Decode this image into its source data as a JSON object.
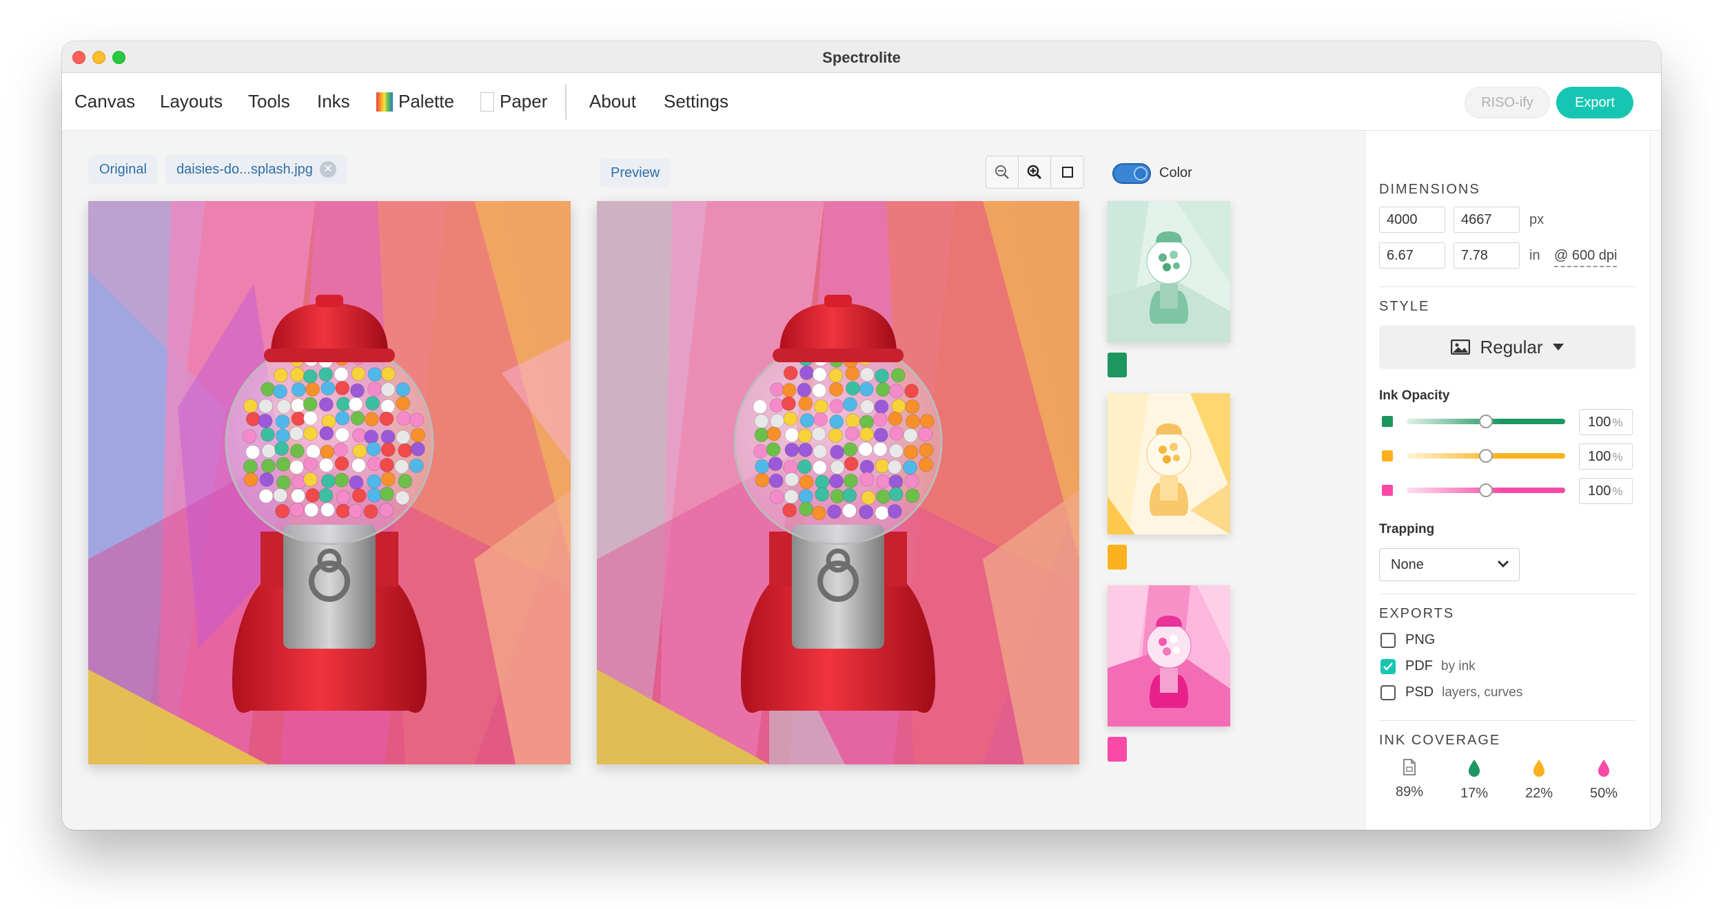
{
  "window": {
    "title": "Spectrolite"
  },
  "menu": {
    "items": [
      "Canvas",
      "Layouts",
      "Tools",
      "Inks"
    ],
    "palette_label": "Palette",
    "paper_label": "Paper",
    "about_label": "About",
    "settings_label": "Settings"
  },
  "actions": {
    "riso_label": "RISO-ify",
    "export_label": "Export"
  },
  "workspace": {
    "original_tab": "Original",
    "file_name": "daisies-do...splash.jpg",
    "preview_tab": "Preview",
    "color_toggle_label": "Color",
    "color_toggle_on": true
  },
  "inks": [
    {
      "name": "green",
      "color": "#1e9660"
    },
    {
      "name": "yellow",
      "color": "#fbb11d"
    },
    {
      "name": "pink",
      "color": "#f94aa8"
    }
  ],
  "sidebar": {
    "dimensions": {
      "title": "DIMENSIONS",
      "width_px": "4000",
      "height_px": "4667",
      "px_unit": "px",
      "width_in": "6.67",
      "height_in": "7.78",
      "in_unit": "in",
      "dpi": "@ 600 dpi"
    },
    "style": {
      "title": "STYLE",
      "value": "Regular"
    },
    "ink_opacity": {
      "label": "Ink Opacity",
      "rows": [
        {
          "value": "100",
          "unit": "%",
          "color": "#1e9660",
          "level": 0.5
        },
        {
          "value": "100",
          "unit": "%",
          "color": "#fbb11d",
          "level": 0.5
        },
        {
          "value": "100",
          "unit": "%",
          "color": "#f94aa8",
          "level": 0.5
        }
      ]
    },
    "trapping": {
      "label": "Trapping",
      "value": "None"
    },
    "exports": {
      "title": "EXPORTS",
      "items": [
        {
          "label": "PNG",
          "sub": "",
          "checked": false
        },
        {
          "label": "PDF",
          "sub": "by ink",
          "checked": true
        },
        {
          "label": "PSD",
          "sub": "layers, curves",
          "checked": false
        }
      ]
    },
    "coverage": {
      "title": "INK COVERAGE",
      "items": [
        {
          "icon": "paper-icon",
          "value": "89%"
        },
        {
          "icon": "green-drop-icon",
          "value": "17%",
          "color": "#1e9660"
        },
        {
          "icon": "yellow-drop-icon",
          "value": "22%",
          "color": "#fbb11d"
        },
        {
          "icon": "pink-drop-icon",
          "value": "50%",
          "color": "#f94aa8"
        }
      ]
    }
  }
}
